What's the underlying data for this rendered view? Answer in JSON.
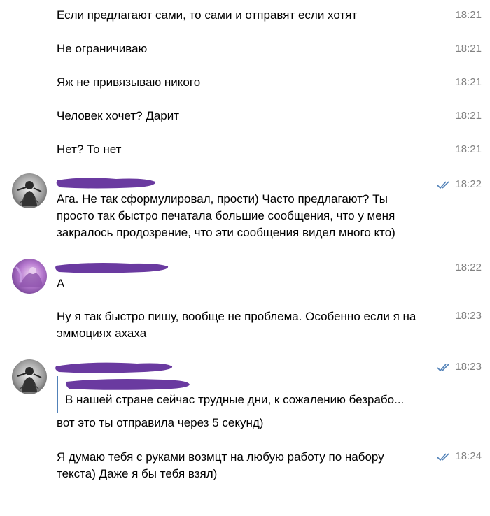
{
  "messages": [
    {
      "text": "Если предлагают сами, то сами и отправят если хотят",
      "time": "18:21"
    },
    {
      "text": "Не ограничиваю",
      "time": "18:21"
    },
    {
      "text": "Яж не привязываю никого",
      "time": "18:21"
    },
    {
      "text": "Человек хочет? Дарит",
      "time": "18:21"
    },
    {
      "text": "Нет? То нет",
      "time": "18:21"
    },
    {
      "text": "Ага. Не так сформулировал, прости) Часто предлагают? Ты просто так быстро печатала большие сообщения, что у меня закралось продозрение, что эти сообщения видел много кто)",
      "time": "18:22"
    },
    {
      "text": "А",
      "time": "18:22"
    },
    {
      "text": "Ну я так быстро пишу, вообще не проблема. Особенно если я на эммоциях ахаха",
      "time": "18:23"
    },
    {
      "quote": "В нашей стране сейчас трудные дни, к сожалению безрабо...",
      "text": "вот это ты отправила через 5 секунд)",
      "time": "18:23"
    },
    {
      "text": "Я думаю тебя с руками возмцт на любую работу по набору текста) Даже я бы тебя взял)",
      "time": "18:24"
    }
  ],
  "colors": {
    "time": "#828282",
    "read_ticks": "#5181b8",
    "redaction": "#6a3aa0",
    "quote_bar": "#5181b8"
  },
  "icons": {
    "read_status": "double-check-icon",
    "avatar_self": "avatar-grayscale-figure",
    "avatar_other": "avatar-purple-figure"
  }
}
